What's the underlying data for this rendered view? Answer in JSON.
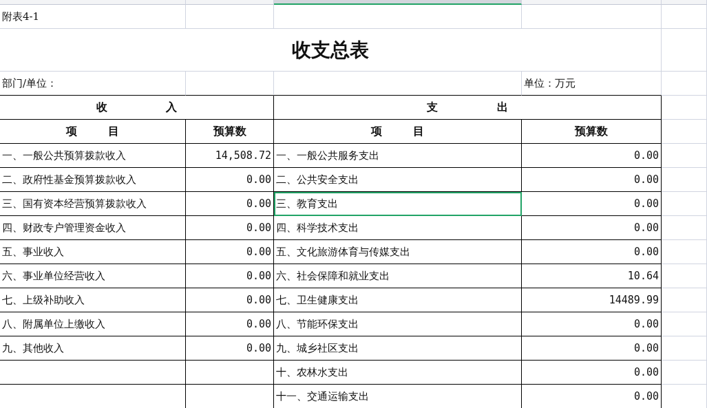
{
  "column_headers": [
    {
      "selected": false
    },
    {
      "selected": false
    },
    {
      "selected": true
    },
    {
      "selected": false
    },
    {
      "selected": false
    }
  ],
  "note": "附表4-1",
  "title": "收支总表",
  "department_label": "部门/单位：",
  "unit_label": "单位：万元",
  "income_header": "收 入",
  "expense_header": "支 出",
  "income_columns": [
    "项 目",
    "预算数"
  ],
  "expense_columns": [
    "项 目",
    "预算数"
  ],
  "rows": [
    {
      "income": {
        "item": "一、一般公共预算拨款收入",
        "amount": "14,508.72"
      },
      "expense": {
        "item": "一、一般公共服务支出",
        "amount": "0.00",
        "selected": false
      }
    },
    {
      "income": {
        "item": "二、政府性基金预算拨款收入",
        "amount": "0.00"
      },
      "expense": {
        "item": "二、公共安全支出",
        "amount": "0.00",
        "selected": false
      }
    },
    {
      "income": {
        "item": "三、国有资本经营预算拨款收入",
        "amount": "0.00"
      },
      "expense": {
        "item": "三、教育支出",
        "amount": "0.00",
        "selected": true
      }
    },
    {
      "income": {
        "item": "四、财政专户管理资金收入",
        "amount": "0.00"
      },
      "expense": {
        "item": "四、科学技术支出",
        "amount": "0.00",
        "selected": false
      }
    },
    {
      "income": {
        "item": "五、事业收入",
        "amount": "0.00"
      },
      "expense": {
        "item": "五、文化旅游体育与传媒支出",
        "amount": "0.00",
        "selected": false
      }
    },
    {
      "income": {
        "item": "六、事业单位经营收入",
        "amount": "0.00"
      },
      "expense": {
        "item": "六、社会保障和就业支出",
        "amount": "10.64",
        "selected": false
      }
    },
    {
      "income": {
        "item": "七、上级补助收入",
        "amount": "0.00"
      },
      "expense": {
        "item": "七、卫生健康支出",
        "amount": "14489.99",
        "selected": false
      }
    },
    {
      "income": {
        "item": "八、附属单位上缴收入",
        "amount": "0.00"
      },
      "expense": {
        "item": "八、节能环保支出",
        "amount": "0.00",
        "selected": false
      }
    },
    {
      "income": {
        "item": "九、其他收入",
        "amount": "0.00"
      },
      "expense": {
        "item": "九、城乡社区支出",
        "amount": "0.00",
        "selected": false
      }
    },
    {
      "expense": {
        "item": "十、农林水支出",
        "amount": "0.00",
        "selected": false
      }
    },
    {
      "expense": {
        "item": "十一、交通运输支出",
        "amount": "0.00",
        "selected": false
      }
    }
  ]
}
